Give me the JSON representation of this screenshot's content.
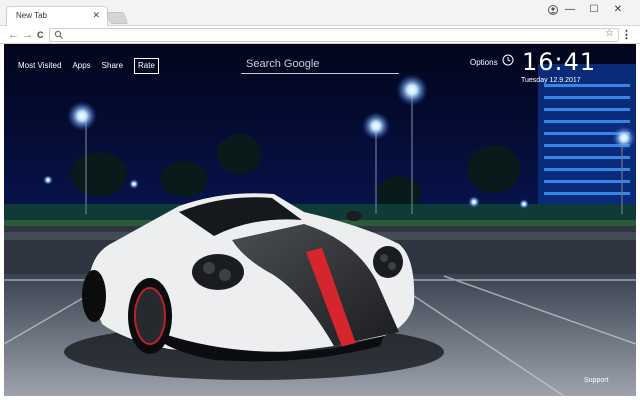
{
  "browser": {
    "tab_title": "New Tab",
    "tab_close": "✕",
    "window_controls": {
      "minimize": "—",
      "maximize": "☐",
      "close": "✕"
    },
    "nav": {
      "back": "←",
      "forward": "→",
      "reload": "C"
    },
    "omnibox_value": "",
    "star": "☆",
    "menu": "⋮"
  },
  "newtab": {
    "links": [
      "Most Visited",
      "Apps",
      "Share"
    ],
    "rate_label": "Rate",
    "search_placeholder": "Search Google",
    "options_label": "Options",
    "time": "16:41",
    "date": "Tuesday  12.9.2017",
    "support_label": "Support"
  },
  "colors": {
    "sky": "#04071f",
    "accent_light": "#9fd8ff",
    "car_body": "#f0f0f0",
    "car_stripe": "#d6262b"
  }
}
